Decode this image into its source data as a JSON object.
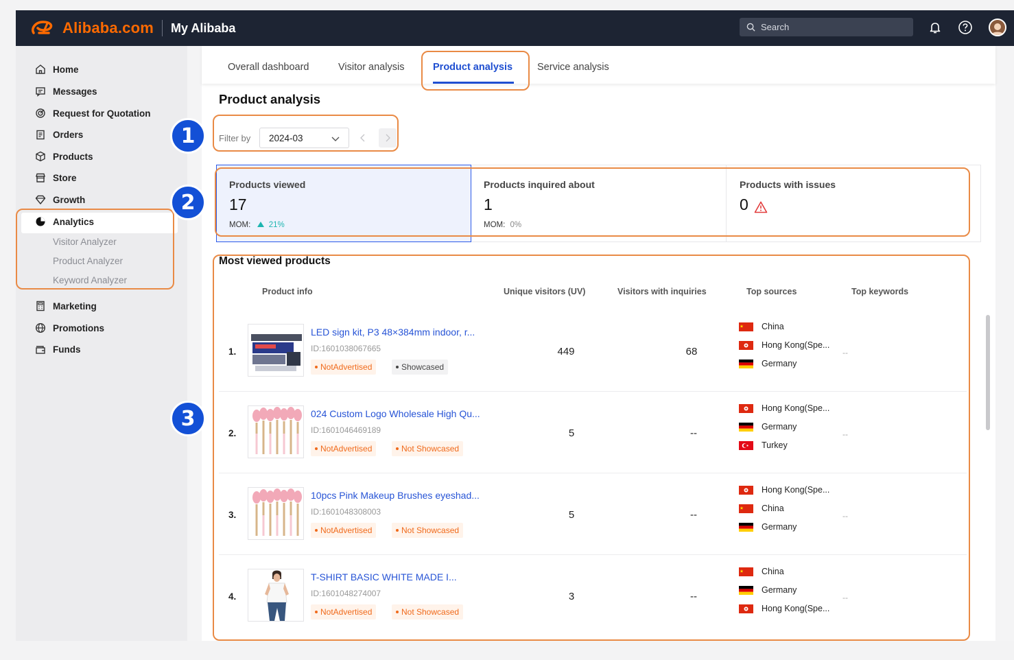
{
  "header": {
    "logo_text": "Alibaba.com",
    "section_title": "My Alibaba",
    "search_placeholder": "Search"
  },
  "sidebar": {
    "items": [
      {
        "label": "Home",
        "icon": "home-icon"
      },
      {
        "label": "Messages",
        "icon": "message-icon"
      },
      {
        "label": "Request for Quotation",
        "icon": "target-icon"
      },
      {
        "label": "Orders",
        "icon": "clipboard-icon"
      },
      {
        "label": "Products",
        "icon": "box-icon"
      },
      {
        "label": "Store",
        "icon": "store-icon"
      },
      {
        "label": "Growth",
        "icon": "diamond-icon"
      },
      {
        "label": "Analytics",
        "icon": "pie-chart-icon"
      },
      {
        "label": "Marketing",
        "icon": "calculator-icon"
      },
      {
        "label": "Promotions",
        "icon": "globe-icon"
      },
      {
        "label": "Funds",
        "icon": "wallet-icon"
      }
    ],
    "analytics_sub": [
      "Visitor Analyzer",
      "Product Analyzer",
      "Keyword Analyzer"
    ]
  },
  "tabs": [
    "Overall dashboard",
    "Visitor analysis",
    "Product analysis",
    "Service analysis"
  ],
  "page_title": "Product analysis",
  "filter": {
    "label": "Filter by",
    "value": "2024-03"
  },
  "kpis": [
    {
      "label": "Products viewed",
      "value": "17",
      "mom_label": "MOM:",
      "mom_value": "21%"
    },
    {
      "label": "Products inquired about",
      "value": "1",
      "mom_label": "MOM:",
      "mom_value": "0%"
    },
    {
      "label": "Products with issues",
      "value": "0"
    }
  ],
  "table": {
    "title": "Most viewed products",
    "columns": [
      "Product info",
      "Unique visitors (UV)",
      "Visitors with inquiries",
      "Top sources",
      "Top keywords"
    ],
    "rows": [
      {
        "rank": "1.",
        "title": "LED sign kit, P3 48×384mm indoor, r...",
        "id": "ID:1601038067665",
        "tags": [
          "NotAdvertised",
          "Showcased"
        ],
        "uv": "449",
        "inquiries": "68",
        "sources": [
          "China",
          "Hong Kong(Spe...",
          "Germany"
        ],
        "keywords": "--"
      },
      {
        "rank": "2.",
        "title": "024 Custom Logo Wholesale High Qu...",
        "id": "ID:1601046469189",
        "tags": [
          "NotAdvertised",
          "Not Showcased"
        ],
        "uv": "5",
        "inquiries": "--",
        "sources": [
          "Hong Kong(Spe...",
          "Germany",
          "Turkey"
        ],
        "keywords": "--"
      },
      {
        "rank": "3.",
        "title": "10pcs Pink Makeup Brushes eyeshad...",
        "id": "ID:1601048308003",
        "tags": [
          "NotAdvertised",
          "Not Showcased"
        ],
        "uv": "5",
        "inquiries": "--",
        "sources": [
          "Hong Kong(Spe...",
          "China",
          "Germany"
        ],
        "keywords": "--"
      },
      {
        "rank": "4.",
        "title": "T-SHIRT BASIC WHITE MADE I...",
        "id": "ID:1601048274007",
        "tags": [
          "NotAdvertised",
          "Not Showcased"
        ],
        "uv": "3",
        "inquiries": "--",
        "sources": [
          "China",
          "Germany",
          "Hong Kong(Spe..."
        ],
        "keywords": "--"
      }
    ]
  },
  "annotations": [
    "1",
    "2",
    "3"
  ],
  "colors": {
    "accent": "#1f4fd1",
    "brand": "#ff6a00",
    "header_bg": "#1d2433",
    "annotation": "#e98a45",
    "badge": "#1350d6"
  }
}
